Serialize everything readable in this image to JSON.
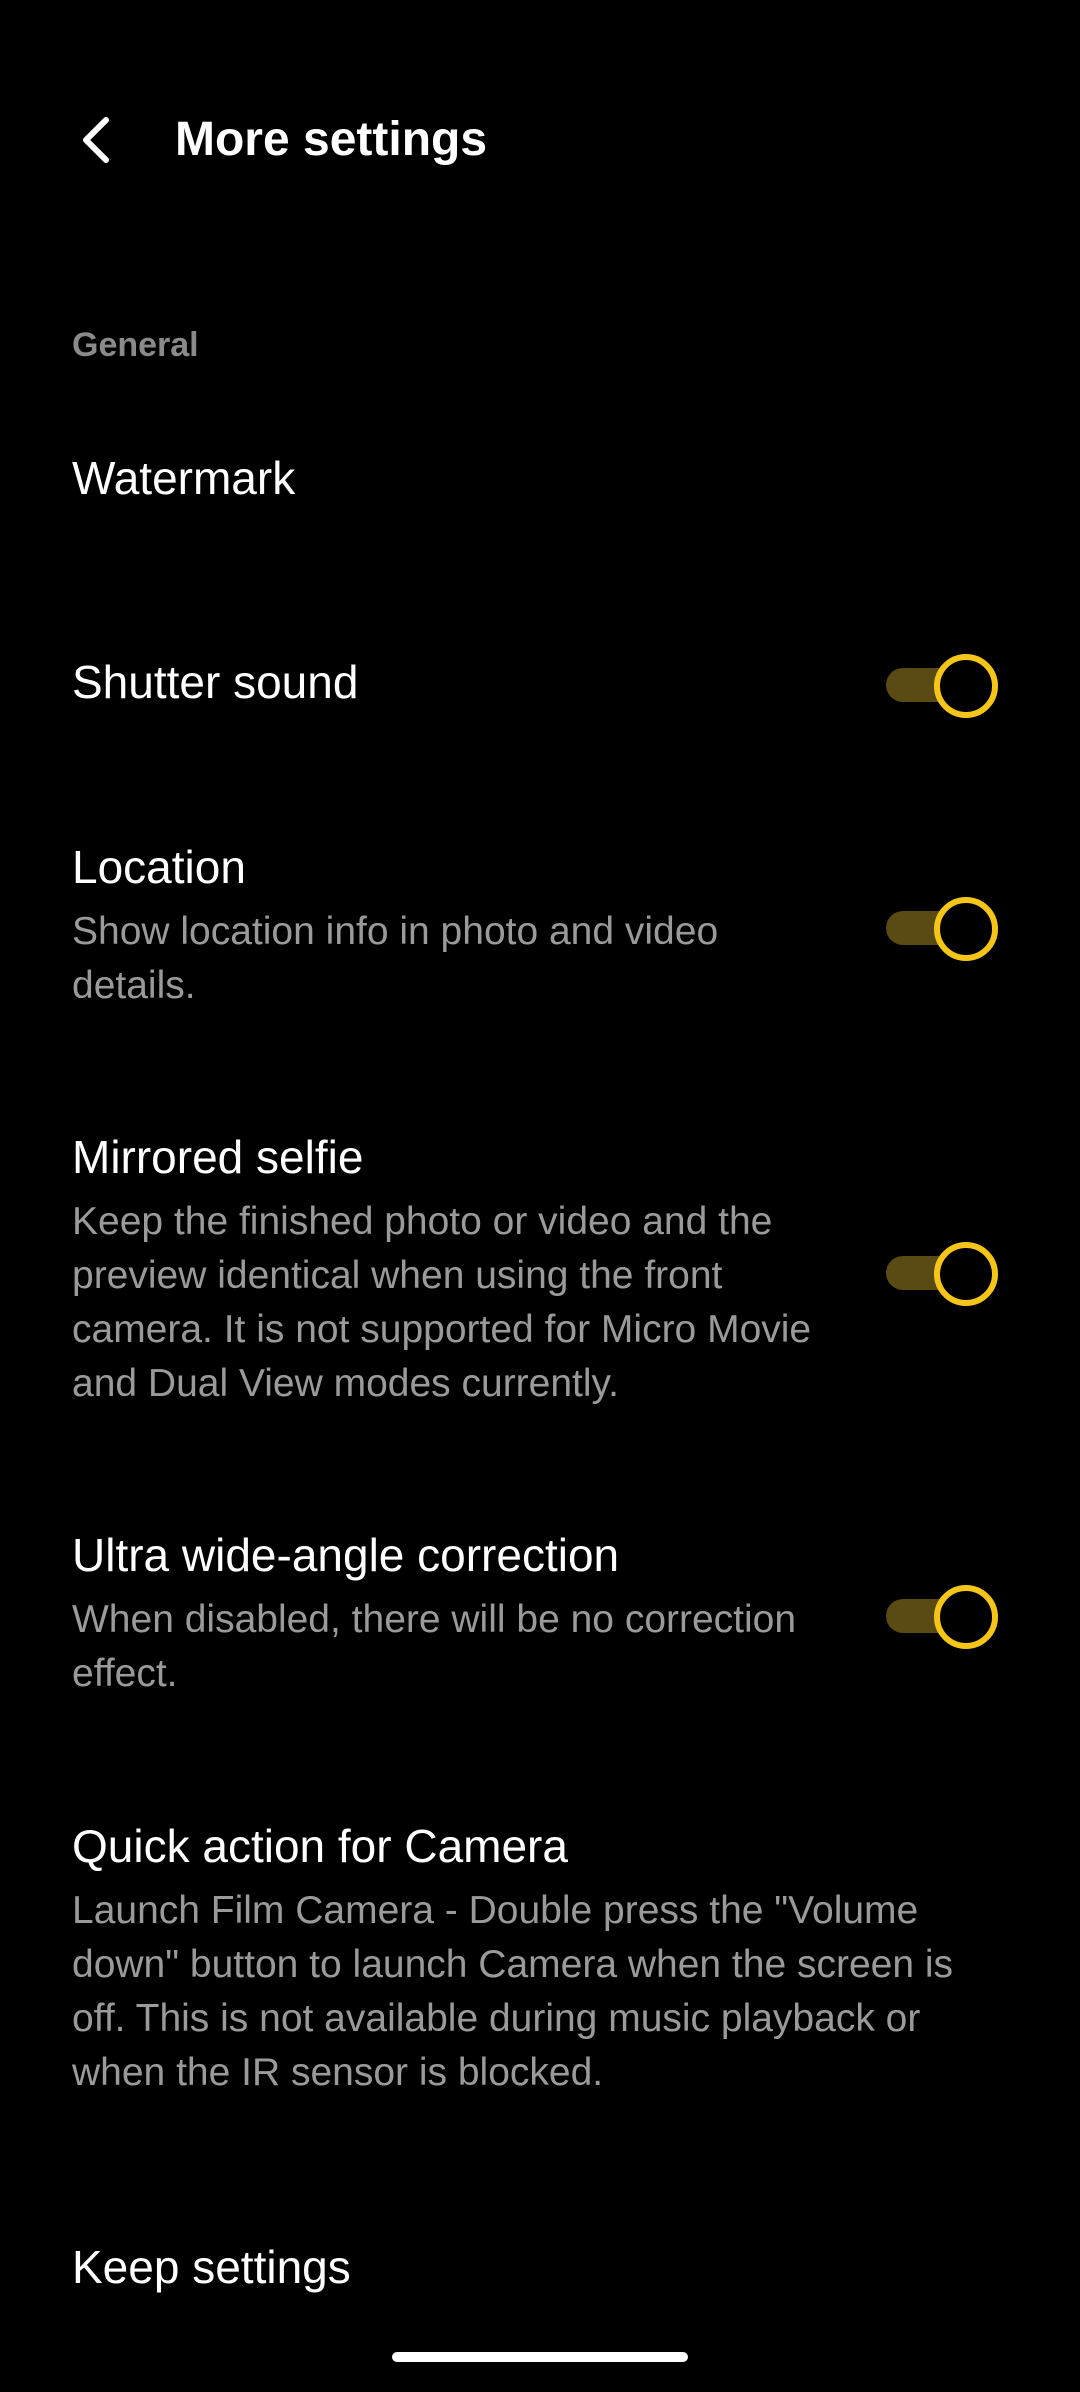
{
  "header": {
    "title": "More settings",
    "back_icon": "chevron-left-icon"
  },
  "section": {
    "label": "General"
  },
  "items": [
    {
      "title": "Watermark"
    },
    {
      "title": "Shutter sound",
      "toggle_on": true
    },
    {
      "title": "Location",
      "description": "Show location info in photo and video details.",
      "toggle_on": true
    },
    {
      "title": "Mirrored selfie",
      "description": "Keep the finished photo or video and the preview identical when using the front camera. It is not supported for Micro Movie and Dual View modes currently.",
      "toggle_on": true
    },
    {
      "title": "Ultra wide-angle correction",
      "description": "When disabled, there will be no correction effect.",
      "toggle_on": true
    },
    {
      "title": "Quick action for Camera",
      "description": "Launch Film Camera - Double press the \"Volume down\" button to launch Camera when the screen is off. This is not available during music playback or when the IR sensor is blocked."
    },
    {
      "title": "Keep settings"
    }
  ],
  "colors": {
    "background": "#000000",
    "accent": "#f5c518",
    "toggle_track": "#5a4a14",
    "secondary_text": "#9a9a9a"
  }
}
